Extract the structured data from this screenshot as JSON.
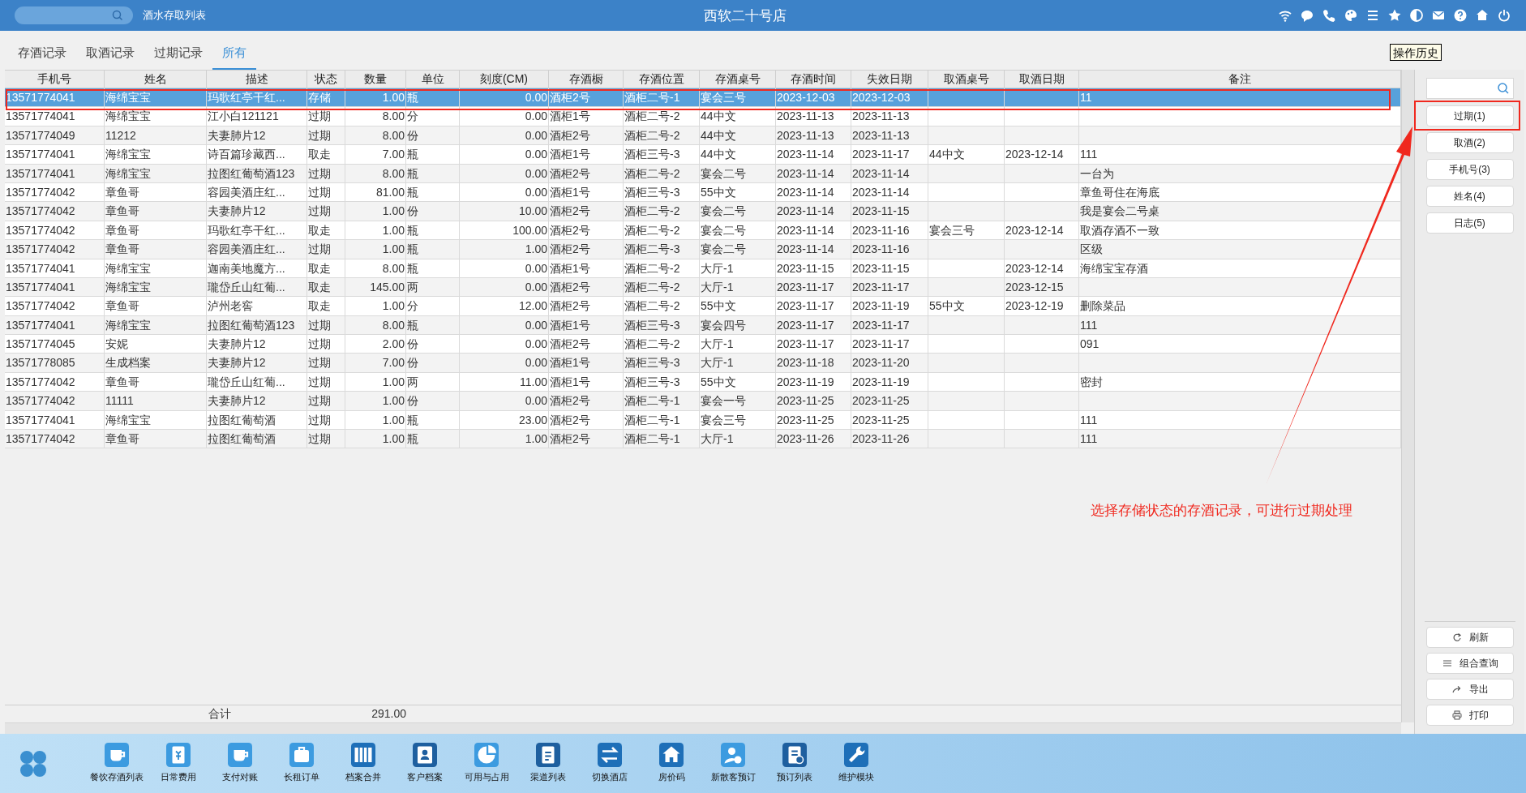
{
  "top_bar": {
    "module_title": "酒水存取列表",
    "store_name": "西软二十号店"
  },
  "tabs": [
    {
      "label": "存酒记录",
      "selected": false
    },
    {
      "label": "取酒记录",
      "selected": false
    },
    {
      "label": "过期记录",
      "selected": false
    },
    {
      "label": "所有",
      "selected": true
    }
  ],
  "history_button": "操作历史",
  "table": {
    "columns": [
      {
        "label": "手机号",
        "kind": "text"
      },
      {
        "label": "姓名",
        "kind": "text"
      },
      {
        "label": "描述",
        "kind": "text"
      },
      {
        "label": "状态",
        "kind": "text"
      },
      {
        "label": "数量",
        "kind": "number"
      },
      {
        "label": "单位",
        "kind": "text"
      },
      {
        "label": "刻度(CM)",
        "kind": "number"
      },
      {
        "label": "存酒橱",
        "kind": "text"
      },
      {
        "label": "存酒位置",
        "kind": "text"
      },
      {
        "label": "存酒桌号",
        "kind": "text"
      },
      {
        "label": "存酒时间",
        "kind": "text"
      },
      {
        "label": "失效日期",
        "kind": "text"
      },
      {
        "label": "取酒桌号",
        "kind": "text"
      },
      {
        "label": "取酒日期",
        "kind": "text"
      },
      {
        "label": "备注",
        "kind": "text"
      }
    ],
    "rows": [
      {
        "selected": true,
        "cells": [
          "13571774041",
          "海绵宝宝",
          "玛歌红亭干红...",
          "存储",
          "1.00",
          "瓶",
          "0.00",
          "酒柜2号",
          "酒柜二号-1",
          "宴会三号",
          "2023-12-03",
          "2023-12-03",
          "",
          "",
          "11"
        ]
      },
      {
        "selected": false,
        "cells": [
          "13571774041",
          "海绵宝宝",
          "江小白121121",
          "过期",
          "8.00",
          "分",
          "0.00",
          "酒柜1号",
          "酒柜二号-2",
          "44中文",
          "2023-11-13",
          "2023-11-13",
          "",
          "",
          ""
        ]
      },
      {
        "selected": false,
        "cells": [
          "13571774049",
          "11212",
          "夫妻肺片12",
          "过期",
          "8.00",
          "份",
          "0.00",
          "酒柜2号",
          "酒柜二号-2",
          "44中文",
          "2023-11-13",
          "2023-11-13",
          "",
          "",
          ""
        ]
      },
      {
        "selected": false,
        "cells": [
          "13571774041",
          "海绵宝宝",
          "诗百篇珍藏西...",
          "取走",
          "7.00",
          "瓶",
          "0.00",
          "酒柜1号",
          "酒柜三号-3",
          "44中文",
          "2023-11-14",
          "2023-11-17",
          "44中文",
          "2023-12-14",
          "111"
        ]
      },
      {
        "selected": false,
        "cells": [
          "13571774041",
          "海绵宝宝",
          "拉图红葡萄酒123",
          "过期",
          "8.00",
          "瓶",
          "0.00",
          "酒柜2号",
          "酒柜二号-2",
          "宴会二号",
          "2023-11-14",
          "2023-11-14",
          "",
          "",
          "一台为"
        ]
      },
      {
        "selected": false,
        "cells": [
          "13571774042",
          "章鱼哥",
          "容园美酒庄红...",
          "过期",
          "81.00",
          "瓶",
          "0.00",
          "酒柜1号",
          "酒柜三号-3",
          "55中文",
          "2023-11-14",
          "2023-11-14",
          "",
          "",
          "章鱼哥住在海底"
        ]
      },
      {
        "selected": false,
        "cells": [
          "13571774042",
          "章鱼哥",
          "夫妻肺片12",
          "过期",
          "1.00",
          "份",
          "10.00",
          "酒柜2号",
          "酒柜二号-2",
          "宴会二号",
          "2023-11-14",
          "2023-11-15",
          "",
          "",
          "我是宴会二号桌"
        ]
      },
      {
        "selected": false,
        "cells": [
          "13571774042",
          "章鱼哥",
          "玛歌红亭干红...",
          "取走",
          "1.00",
          "瓶",
          "100.00",
          "酒柜2号",
          "酒柜二号-2",
          "宴会二号",
          "2023-11-14",
          "2023-11-16",
          "宴会三号",
          "2023-12-14",
          "取酒存酒不一致"
        ]
      },
      {
        "selected": false,
        "cells": [
          "13571774042",
          "章鱼哥",
          "容园美酒庄红...",
          "过期",
          "1.00",
          "瓶",
          "1.00",
          "酒柜2号",
          "酒柜二号-3",
          "宴会二号",
          "2023-11-14",
          "2023-11-16",
          "",
          "",
          "区级"
        ]
      },
      {
        "selected": false,
        "cells": [
          "13571774041",
          "海绵宝宝",
          "迦南美地魔方...",
          "取走",
          "8.00",
          "瓶",
          "0.00",
          "酒柜1号",
          "酒柜二号-2",
          "大厅-1",
          "2023-11-15",
          "2023-11-15",
          "",
          "2023-12-14",
          "海绵宝宝存酒"
        ]
      },
      {
        "selected": false,
        "cells": [
          "13571774041",
          "海绵宝宝",
          "瓏岱丘山红葡...",
          "取走",
          "145.00",
          "两",
          "0.00",
          "酒柜2号",
          "酒柜二号-2",
          "大厅-1",
          "2023-11-17",
          "2023-11-17",
          "",
          "2023-12-15",
          ""
        ]
      },
      {
        "selected": false,
        "cells": [
          "13571774042",
          "章鱼哥",
          "泸州老窖",
          "取走",
          "1.00",
          "分",
          "12.00",
          "酒柜2号",
          "酒柜二号-2",
          "55中文",
          "2023-11-17",
          "2023-11-19",
          "55中文",
          "2023-12-19",
          "删除菜品"
        ]
      },
      {
        "selected": false,
        "cells": [
          "13571774041",
          "海绵宝宝",
          "拉图红葡萄酒123",
          "过期",
          "8.00",
          "瓶",
          "0.00",
          "酒柜1号",
          "酒柜三号-3",
          "宴会四号",
          "2023-11-17",
          "2023-11-17",
          "",
          "",
          "111"
        ]
      },
      {
        "selected": false,
        "cells": [
          "13571774045",
          "安妮",
          "夫妻肺片12",
          "过期",
          "2.00",
          "份",
          "0.00",
          "酒柜2号",
          "酒柜二号-2",
          "大厅-1",
          "2023-11-17",
          "2023-11-17",
          "",
          "",
          "091"
        ]
      },
      {
        "selected": false,
        "cells": [
          "13571778085",
          "生成档案",
          "夫妻肺片12",
          "过期",
          "7.00",
          "份",
          "0.00",
          "酒柜1号",
          "酒柜三号-3",
          "大厅-1",
          "2023-11-18",
          "2023-11-20",
          "",
          "",
          ""
        ]
      },
      {
        "selected": false,
        "cells": [
          "13571774042",
          "章鱼哥",
          "瓏岱丘山红葡...",
          "过期",
          "1.00",
          "两",
          "11.00",
          "酒柜1号",
          "酒柜三号-3",
          "55中文",
          "2023-11-19",
          "2023-11-19",
          "",
          "",
          "密封"
        ]
      },
      {
        "selected": false,
        "cells": [
          "13571774042",
          "11111",
          "夫妻肺片12",
          "过期",
          "1.00",
          "份",
          "0.00",
          "酒柜2号",
          "酒柜二号-1",
          "宴会一号",
          "2023-11-25",
          "2023-11-25",
          "",
          "",
          ""
        ]
      },
      {
        "selected": false,
        "cells": [
          "13571774041",
          "海绵宝宝",
          "拉图红葡萄酒",
          "过期",
          "1.00",
          "瓶",
          "23.00",
          "酒柜2号",
          "酒柜二号-1",
          "宴会三号",
          "2023-11-25",
          "2023-11-25",
          "",
          "",
          "111"
        ]
      },
      {
        "selected": false,
        "cells": [
          "13571774042",
          "章鱼哥",
          "拉图红葡萄酒",
          "过期",
          "1.00",
          "瓶",
          "1.00",
          "酒柜2号",
          "酒柜二号-1",
          "大厅-1",
          "2023-11-26",
          "2023-11-26",
          "",
          "",
          "111"
        ]
      }
    ],
    "summary": {
      "label": "合计",
      "quantity": "291.00"
    }
  },
  "side_panel": {
    "actions": [
      "过期(1)",
      "取酒(2)",
      "手机号(3)",
      "姓名(4)",
      "日志(5)"
    ],
    "tools": [
      "刷新",
      "组合查询",
      "导出",
      "打印"
    ]
  },
  "annotation": "选择存储状态的存酒记录，可进行过期处理",
  "taskbar": [
    "餐饮存酒列表",
    "日常费用",
    "支付对账",
    "长租订单",
    "档案合并",
    "客户档案",
    "可用与占用",
    "渠道列表",
    "切换酒店",
    "房价码",
    "新散客预订",
    "预订列表",
    "维护模块"
  ]
}
